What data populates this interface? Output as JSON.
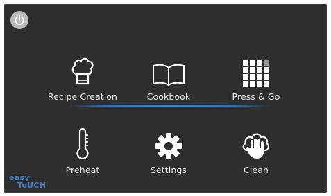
{
  "menu": {
    "power_icon": "power-icon",
    "tiles": [
      {
        "label": "Recipe Creation",
        "icon": "chef-hat-icon"
      },
      {
        "label": "Cookbook",
        "icon": "open-book-icon"
      },
      {
        "label": "Press & Go",
        "icon": "grid-icon"
      },
      {
        "label": "Preheat",
        "icon": "thermometer-icon"
      },
      {
        "label": "Settings",
        "icon": "gear-icon"
      },
      {
        "label": "Clean",
        "icon": "cleaning-hand-icon"
      }
    ]
  },
  "brand": {
    "line1": "easy",
    "line2": "ToUCH"
  },
  "colors": {
    "background": "#2e2e2e",
    "text": "#e8e8e8",
    "accent": "#1e78d2",
    "power_button": "#bdbdbd"
  }
}
